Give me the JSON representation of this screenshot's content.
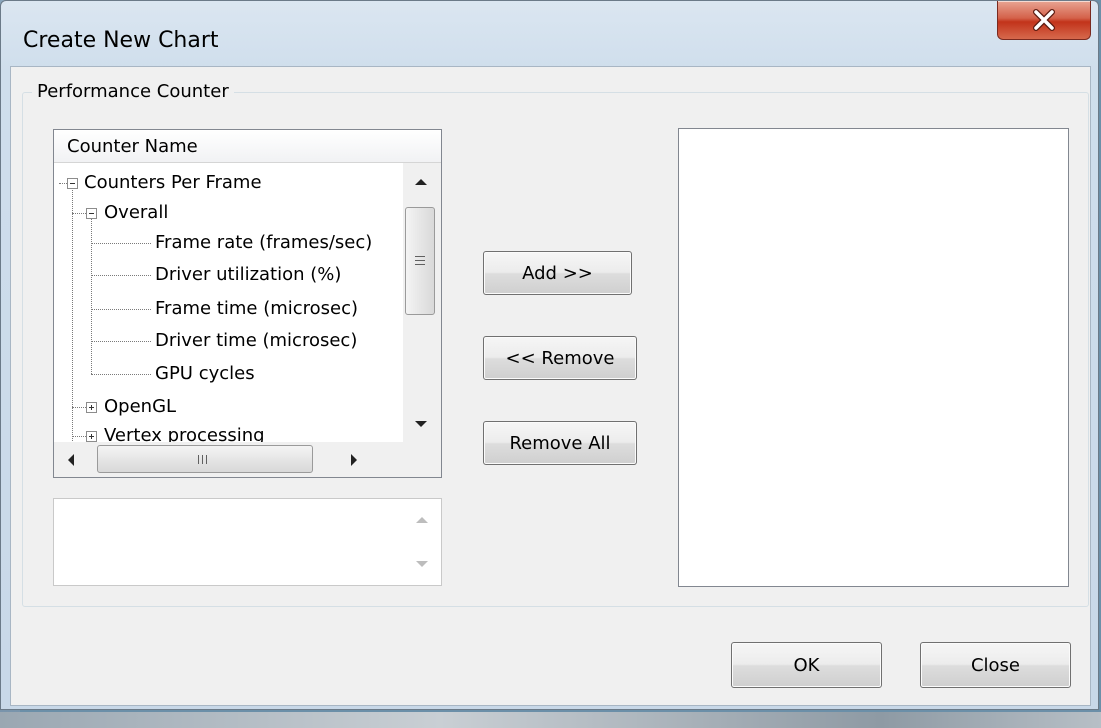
{
  "window": {
    "title": "Create New Chart"
  },
  "group": {
    "label": "Performance Counter"
  },
  "tree": {
    "header": "Counter Name",
    "root": "Counters Per Frame",
    "overall": "Overall",
    "overall_items": [
      "Frame rate (frames/sec)",
      "Driver utilization (%)",
      "Frame time (microsec)",
      "Driver time (microsec)",
      "GPU cycles"
    ],
    "opengl": "OpenGL",
    "vertex": "Vertex processing"
  },
  "buttons": {
    "add": "Add >>",
    "remove": "<< Remove",
    "remove_all": "Remove All",
    "ok": "OK",
    "close": "Close"
  },
  "icons": {
    "close": "close-x-icon",
    "expand": "plus-box-icon",
    "collapse": "minus-box-icon"
  }
}
